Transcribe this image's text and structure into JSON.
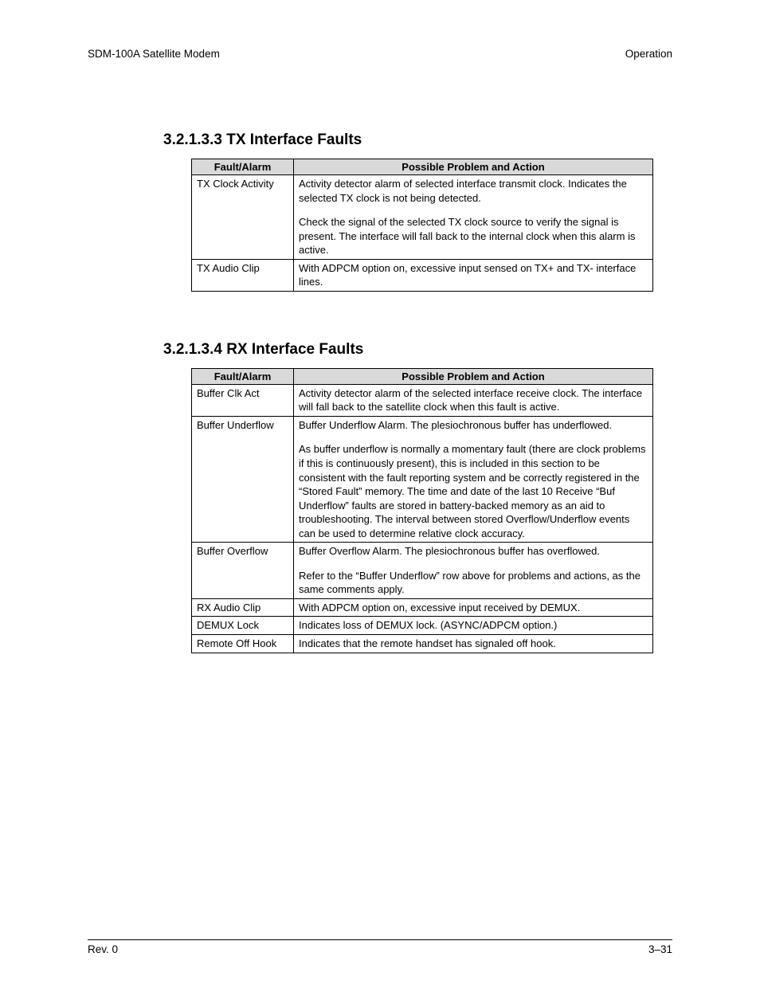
{
  "header": {
    "left": "SDM-100A Satellite Modem",
    "right": "Operation"
  },
  "section1": {
    "title": "3.2.1.3.3  TX Interface Faults",
    "col1": "Fault/Alarm",
    "col2": "Possible Problem and Action",
    "rows": [
      {
        "fault": "TX Clock Activity",
        "desc1": "Activity detector alarm of selected interface transmit clock. Indicates the selected TX clock is not being detected.",
        "desc2": "Check the signal of the selected TX clock source to verify the signal is present. The interface will fall back to the internal clock when this alarm is active."
      },
      {
        "fault": "TX Audio Clip",
        "desc1": "With ADPCM option on, excessive input sensed on TX+ and TX- interface lines."
      }
    ]
  },
  "section2": {
    "title": "3.2.1.3.4  RX Interface Faults",
    "col1": "Fault/Alarm",
    "col2": "Possible Problem and Action",
    "rows": [
      {
        "fault": "Buffer Clk Act",
        "desc1": "Activity detector alarm of the selected interface receive clock. The interface will fall back to the satellite clock when this fault is active."
      },
      {
        "fault": "Buffer Underflow",
        "desc1": "Buffer Underflow Alarm. The plesiochronous buffer has underflowed.",
        "desc2": "As buffer underflow is normally a momentary fault (there are clock problems if this is continuously present), this is included in this section to be consistent with the fault reporting system and be correctly registered in the “Stored Fault” memory. The time and date of the last 10 Receive “Buf Underflow” faults are stored in battery-backed memory as an aid to troubleshooting. The interval between stored Overflow/Underflow events can be used to determine relative clock accuracy."
      },
      {
        "fault": "Buffer Overflow",
        "desc1": "Buffer Overflow Alarm. The plesiochronous buffer has overflowed.",
        "desc2": "Refer to the “Buffer Underflow” row above for problems and actions, as the same comments apply."
      },
      {
        "fault": "RX Audio Clip",
        "desc1": "With ADPCM option on, excessive input received by DEMUX."
      },
      {
        "fault": "DEMUX Lock",
        "desc1": "Indicates loss of DEMUX lock. (ASYNC/ADPCM option.)"
      },
      {
        "fault": "Remote Off Hook",
        "desc1": "Indicates that the remote handset has signaled off hook."
      }
    ]
  },
  "footer": {
    "left": "Rev. 0",
    "right": "3–31"
  }
}
